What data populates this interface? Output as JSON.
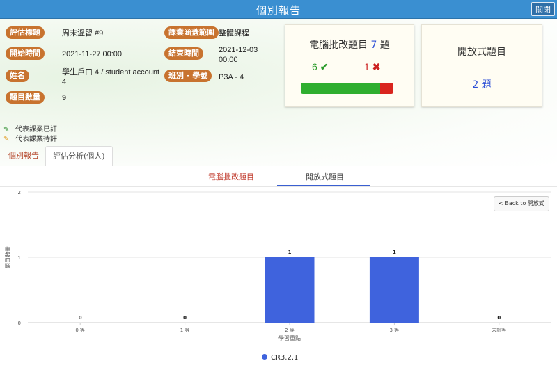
{
  "window": {
    "title": "個別報告",
    "close_label": "關閉"
  },
  "info": {
    "assessment_title_label": "評估標題",
    "assessment_title_value": "周末溫習 #9",
    "coverage_label": "課業涵蓋範圍",
    "coverage_value": "整體課程",
    "start_label": "開始時間",
    "start_value": "2021-11-27 00:00",
    "end_label": "結束時間",
    "end_value_line1": "2021-12-03",
    "end_value_line2": "00:00",
    "name_label": "姓名",
    "name_value_line1": "學生戶口 4 / student account",
    "name_value_line2": "4",
    "class_label": "班別 - 學號",
    "class_value": "P3A - 4",
    "count_label": "題目數量",
    "count_value": "9"
  },
  "auto_card": {
    "title": "電腦批改題目",
    "count": "7",
    "unit": "題",
    "correct": "6",
    "wrong": "1",
    "correct_fraction": 0.86
  },
  "open_card": {
    "title": "開放式題目",
    "count_text": "2 題"
  },
  "status_legend": {
    "graded": "代表課業已評",
    "pending": "代表課業待評"
  },
  "tabs": [
    {
      "label": "個別報告"
    },
    {
      "label": "評估分析(個人)"
    }
  ],
  "subtabs": [
    {
      "label": "電腦批改題目"
    },
    {
      "label": "開放式題目"
    }
  ],
  "back_button": "< Back to 開放式",
  "colors": {
    "bar": "#3f63dd",
    "header": "#3a8fd1",
    "label_pill": "#c8732f"
  },
  "chart_data": {
    "type": "bar",
    "categories": [
      "0 等",
      "1 等",
      "2 等",
      "3 等",
      "未評等"
    ],
    "series": [
      {
        "name": "CR3.2.1",
        "values": [
          0,
          0,
          1,
          1,
          0
        ]
      }
    ],
    "xlabel": "學習重點",
    "ylabel": "題目數量",
    "ylim": [
      0,
      2
    ],
    "yticks": [
      "0",
      "1",
      "2"
    ],
    "legend": "bottom-center"
  }
}
